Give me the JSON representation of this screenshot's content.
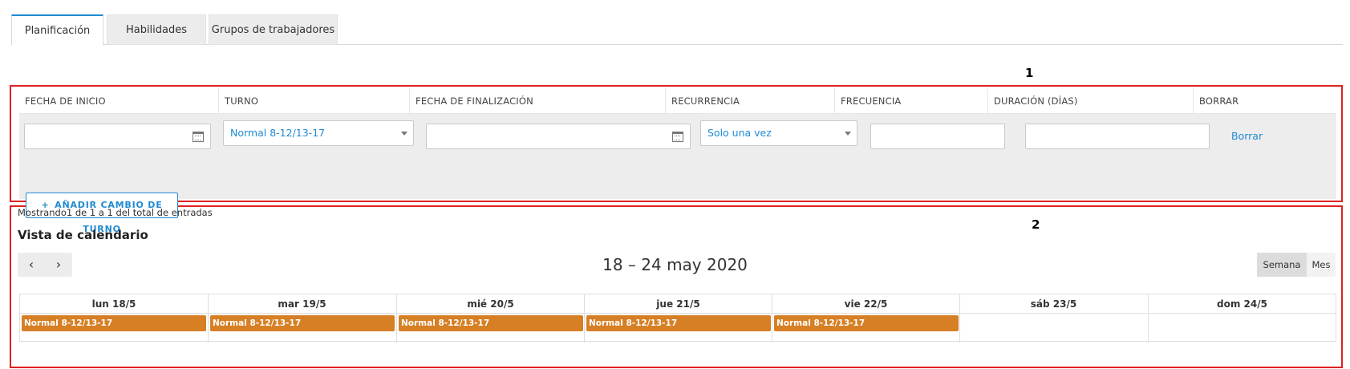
{
  "tabs": [
    {
      "label": "Planificación",
      "active": true
    },
    {
      "label": "Habilidades",
      "active": false
    },
    {
      "label": "Grupos de trabajadores",
      "active": false
    }
  ],
  "markers": {
    "one": "1",
    "two": "2"
  },
  "shift_table": {
    "columns": [
      "FECHA DE INICIO",
      "TURNO",
      "FECHA DE FINALIZACIÓN",
      "RECURRENCIA",
      "FRECUENCIA",
      "DURACIÓN (DÍAS)",
      "BORRAR"
    ],
    "row": {
      "start_date": "",
      "shift": "Normal 8-12/13-17",
      "end_date": "",
      "recurrence": "Solo una vez",
      "frequency": "",
      "duration": "",
      "delete_label": "Borrar"
    },
    "add_button_label": "AÑADIR CAMBIO DE TURNO",
    "add_button_icon": "plus-icon"
  },
  "calendar": {
    "entries_text": "Mostrando1 de 1 a 1 del total de entradas",
    "title": "Vista de calendario",
    "prev_icon": "chevron-left-icon",
    "next_icon": "chevron-right-icon",
    "date_range": "18 – 24 may 2020",
    "view_week": "Semana",
    "view_month": "Mes",
    "active_view": "Semana",
    "event_color": "#d67f24",
    "days": [
      {
        "label": "lun 18/5",
        "event": "Normal 8-12/13-17"
      },
      {
        "label": "mar 19/5",
        "event": "Normal 8-12/13-17"
      },
      {
        "label": "mié 20/5",
        "event": "Normal 8-12/13-17"
      },
      {
        "label": "jue 21/5",
        "event": "Normal 8-12/13-17"
      },
      {
        "label": "vie 22/5",
        "event": "Normal 8-12/13-17"
      },
      {
        "label": "sáb 23/5",
        "event": ""
      },
      {
        "label": "dom 24/5",
        "event": ""
      }
    ]
  },
  "colors": {
    "accent": "#1f8ad3",
    "highlight_border": "#e02020"
  }
}
